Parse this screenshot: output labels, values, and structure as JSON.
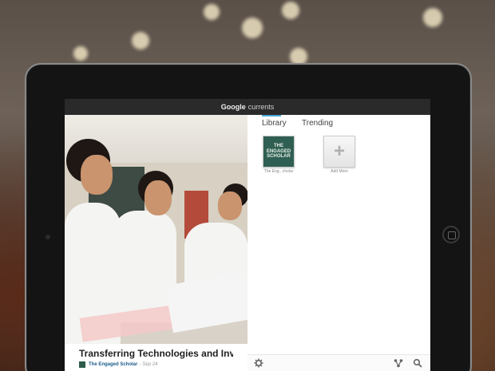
{
  "app": {
    "brand": "Google",
    "product": "currents"
  },
  "article": {
    "title": "Transferring Technologies and Invent...",
    "source": "The Engaged Scholar",
    "separator": "-",
    "date": "Sep 24"
  },
  "library": {
    "tabs": [
      {
        "label": "Library",
        "active": true
      },
      {
        "label": "Trending",
        "active": false
      }
    ],
    "tiles": [
      {
        "label": "The Eng...cholar",
        "thumb_text": "THE ENGAGED SCHOLAR",
        "type": "edition"
      },
      {
        "label": "Add More",
        "thumb_text": "+",
        "type": "add"
      }
    ]
  },
  "toolbar": {
    "icons": [
      "gear-icon",
      "share-icon",
      "search-icon"
    ]
  },
  "colors": {
    "accent": "#4aa6d8",
    "topbar": "#2a2a2a",
    "source_link": "#1a5c8a",
    "scholar_tile": "#2f5f52"
  }
}
